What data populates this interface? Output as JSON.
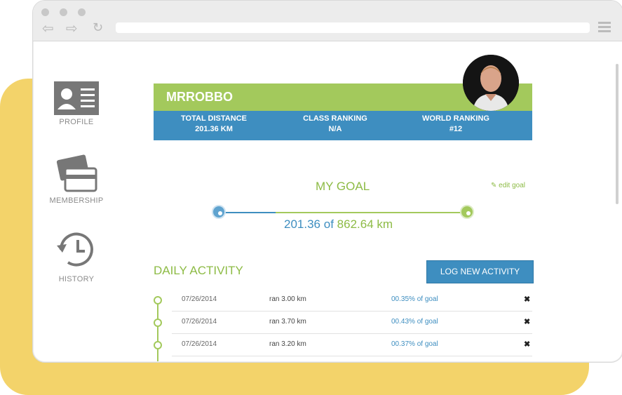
{
  "sidebar": {
    "items": [
      {
        "label": "PROFILE",
        "icon": "profile-card-icon"
      },
      {
        "label": "MEMBERSHIP",
        "icon": "credit-card-icon"
      },
      {
        "label": "HISTORY",
        "icon": "history-clock-icon"
      }
    ]
  },
  "profile": {
    "username": "MRROBBO",
    "stats": [
      {
        "label": "TOTAL DISTANCE",
        "value": "201.36 KM"
      },
      {
        "label": "CLASS RANKING",
        "value": "N/A"
      },
      {
        "label": "WORLD RANKING",
        "value": "#12"
      }
    ]
  },
  "goal": {
    "title": "MY GOAL",
    "edit_label": "edit goal",
    "current": "201.36",
    "separator": "of",
    "target": "862.64 km",
    "progress_fraction": 0.23
  },
  "daily": {
    "title": "DAILY ACTIVITY",
    "log_button": "LOG NEW ACTIVITY",
    "rows": [
      {
        "date": "07/26/2014",
        "activity": "ran 3.00 km",
        "percent": "00.35% of goal"
      },
      {
        "date": "07/26/2014",
        "activity": "ran 3.70 km",
        "percent": "00.43% of goal"
      },
      {
        "date": "07/26/2014",
        "activity": "ran 3.20 km",
        "percent": "00.37% of goal"
      }
    ]
  },
  "colors": {
    "green": "#a3c95c",
    "blue": "#3e8ec0",
    "yellow": "#f3d36a"
  }
}
